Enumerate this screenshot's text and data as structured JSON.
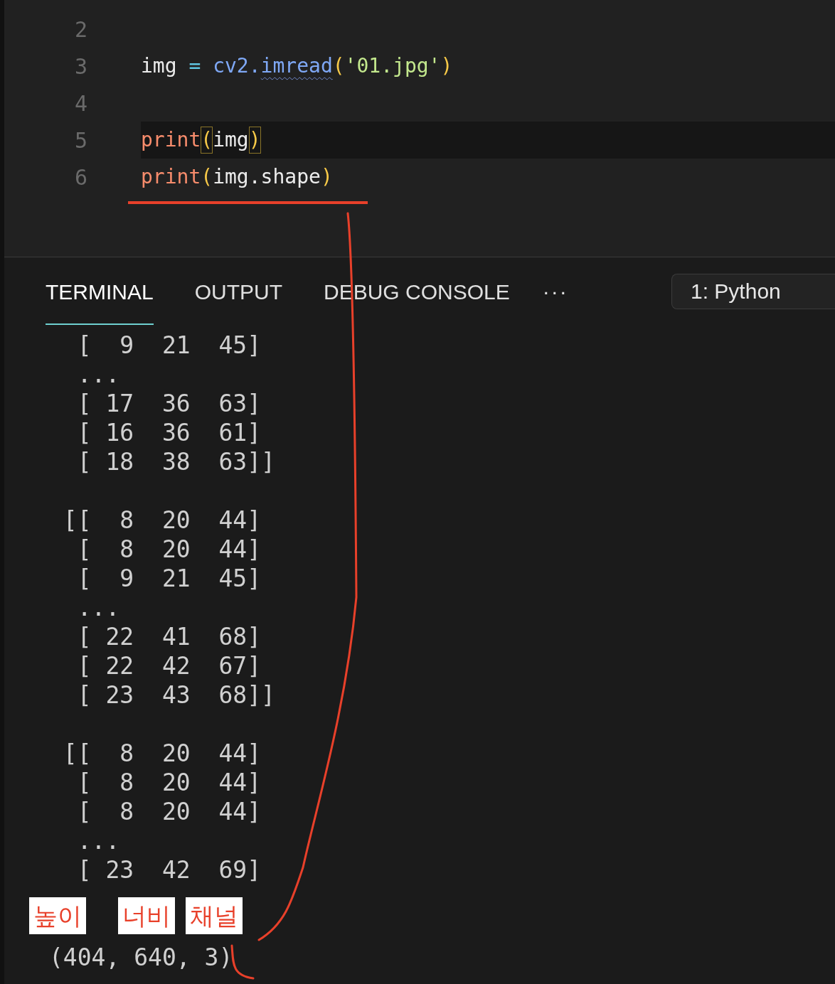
{
  "editor": {
    "lines": [
      {
        "number": "2"
      },
      {
        "number": "3",
        "tokens": [
          {
            "text": "img",
            "kind": "var"
          },
          {
            "text": " =",
            "kind": "op"
          },
          {
            "text": " cv2.",
            "kind": "module"
          },
          {
            "text": "imread",
            "kind": "func",
            "squiggle": true
          },
          {
            "text": "(",
            "kind": "paren"
          },
          {
            "text": "'01.jpg'",
            "kind": "string"
          },
          {
            "text": ")",
            "kind": "paren"
          }
        ]
      },
      {
        "number": "4"
      },
      {
        "number": "5",
        "highlighted": true,
        "tokens": [
          {
            "text": "print",
            "kind": "builtin"
          },
          {
            "text": "(",
            "kind": "paren",
            "bracket_match": true
          },
          {
            "text": "img",
            "kind": "var"
          },
          {
            "text": ")",
            "kind": "paren",
            "bracket_match": true
          }
        ]
      },
      {
        "number": "6",
        "underlined": true,
        "tokens": [
          {
            "text": "print",
            "kind": "builtin"
          },
          {
            "text": "(",
            "kind": "paren"
          },
          {
            "text": "img.shape",
            "kind": "var"
          },
          {
            "text": ")",
            "kind": "paren"
          }
        ]
      }
    ]
  },
  "panel": {
    "tabs": [
      {
        "label": "TERMINAL",
        "selected": true
      },
      {
        "label": "OUTPUT",
        "selected": false
      },
      {
        "label": "DEBUG CONSOLE",
        "selected": false
      }
    ],
    "more": "···",
    "terminal_select": "1: Python"
  },
  "terminal": {
    "lines": [
      {
        "kind": "output",
        "text": "  [  9  21  45]"
      },
      {
        "kind": "output",
        "text": "  ..."
      },
      {
        "kind": "output",
        "text": "  [ 17  36  63]"
      },
      {
        "kind": "output",
        "text": "  [ 16  36  61]"
      },
      {
        "kind": "output",
        "text": "  [ 18  38  63]]"
      },
      {
        "kind": "blank"
      },
      {
        "kind": "output",
        "text": " [[  8  20  44]"
      },
      {
        "kind": "output",
        "text": "  [  8  20  44]"
      },
      {
        "kind": "output",
        "text": "  [  9  21  45]"
      },
      {
        "kind": "output",
        "text": "  ..."
      },
      {
        "kind": "output",
        "text": "  [ 22  41  68]"
      },
      {
        "kind": "output",
        "text": "  [ 22  42  67]"
      },
      {
        "kind": "output",
        "text": "  [ 23  43  68]]"
      },
      {
        "kind": "blank"
      },
      {
        "kind": "output",
        "text": " [[  8  20  44]"
      },
      {
        "kind": "output",
        "text": "  [  8  20  44]"
      },
      {
        "kind": "output",
        "text": "  [  8  20  44]"
      },
      {
        "kind": "output",
        "text": "  ..."
      },
      {
        "kind": "output",
        "text": "  [ 23  42  69]"
      },
      {
        "kind": "labels",
        "labels": [
          "높이",
          "너비",
          "채널"
        ]
      },
      {
        "kind": "output",
        "text": "(404, 640, 3)"
      }
    ]
  }
}
